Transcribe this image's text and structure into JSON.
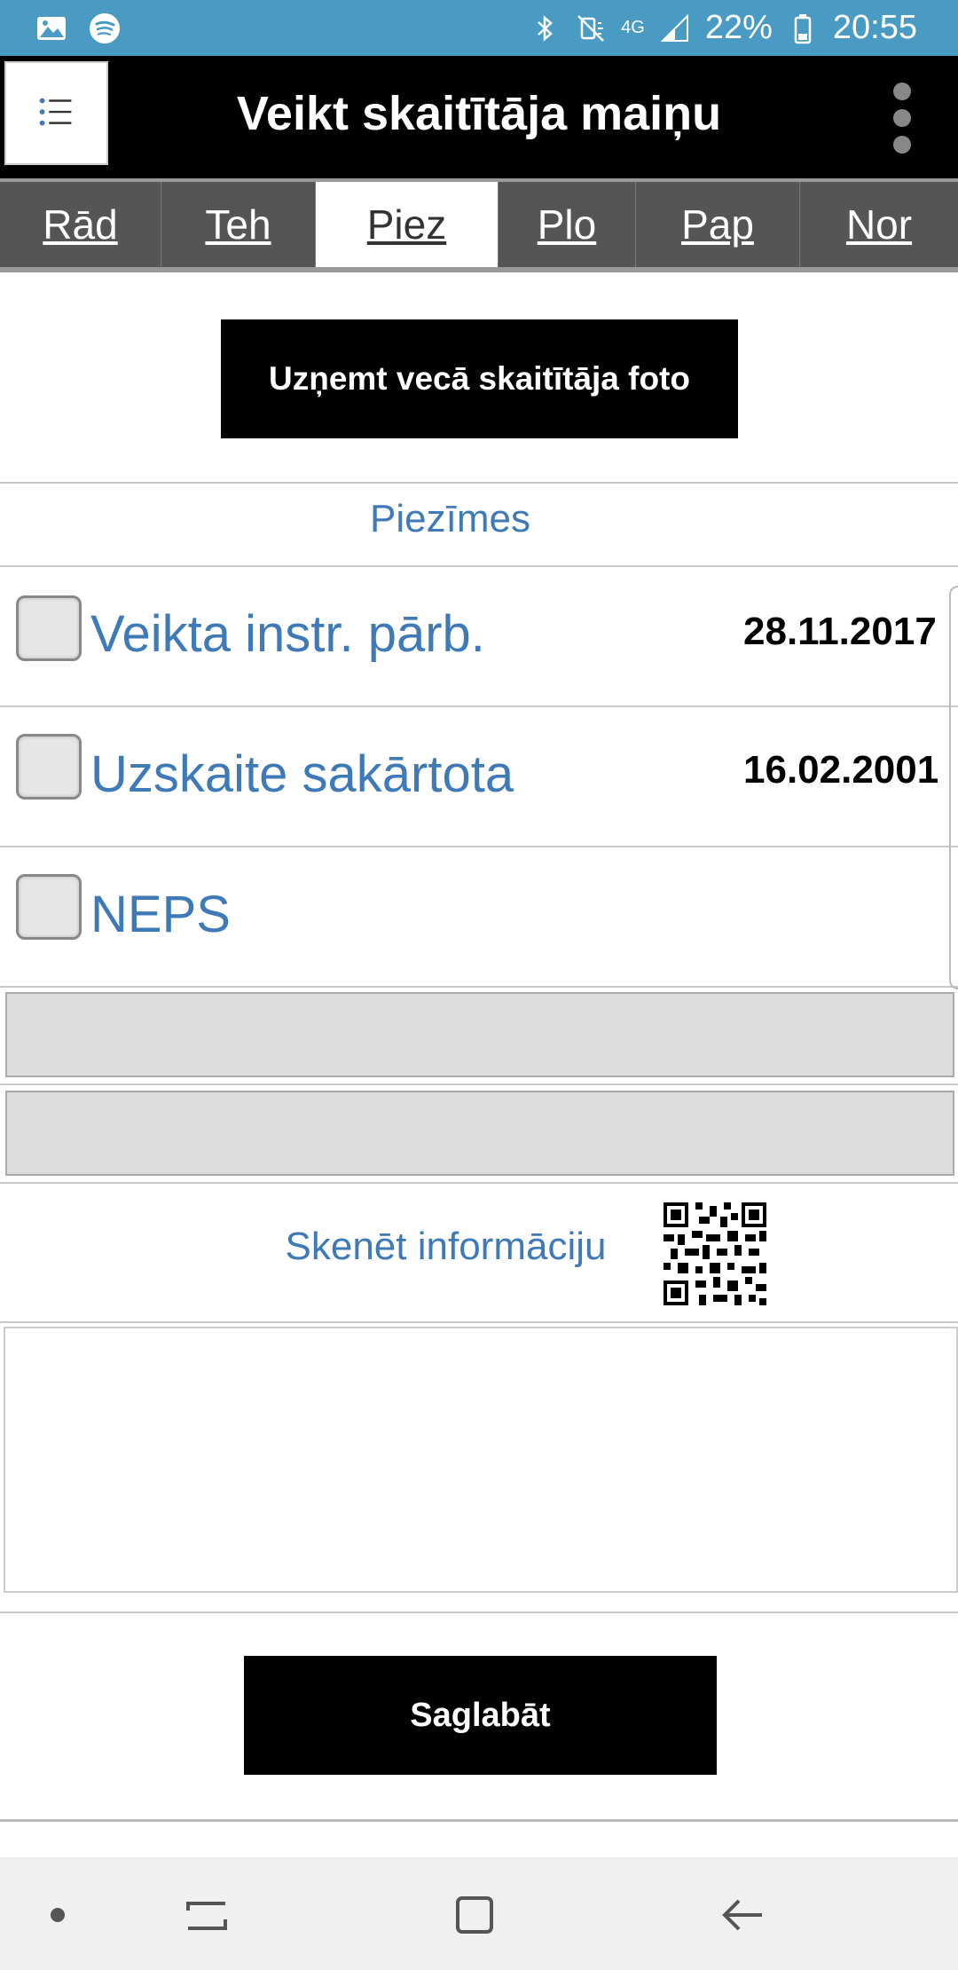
{
  "status_bar": {
    "battery": "22%",
    "time": "20:55",
    "network": "4G",
    "left_icons": [
      "gallery-icon",
      "spotify-icon"
    ],
    "right_icons": [
      "bluetooth-icon",
      "mute-icon",
      "signal-icon",
      "battery-icon"
    ]
  },
  "header": {
    "title": "Veikt skaitītāja maiņu",
    "menu_icon": "list-icon",
    "overflow_icon": "more-vert-icon"
  },
  "tabs": [
    {
      "label": "Rād",
      "active": false
    },
    {
      "label": "Teh",
      "active": false
    },
    {
      "label": "Piez",
      "active": true
    },
    {
      "label": "Plo",
      "active": false
    },
    {
      "label": "Pap",
      "active": false
    },
    {
      "label": "Nor",
      "active": false
    }
  ],
  "photo_button": "Uzņemt vecā skaitītāja foto",
  "notes_label": "Piezīmes",
  "checks": [
    {
      "label": "Veikta instr. pārb.",
      "date": "28.11.2017",
      "checked": false
    },
    {
      "label": "Uzskaite sakārtota",
      "date": "16.02.2001",
      "checked": false
    },
    {
      "label": "NEPS",
      "date": "",
      "checked": false
    }
  ],
  "fields": [
    {
      "value": ""
    },
    {
      "value": ""
    }
  ],
  "scan_label": "Skenēt informāciju",
  "scan_icon": "qr-code-icon",
  "notes_text": "",
  "save_button": "Saglabāt",
  "nav": [
    "dot-icon",
    "recent-apps-icon",
    "home-icon",
    "back-icon"
  ],
  "colors": {
    "status_bar": "#4a9bc4",
    "accent_text": "#3f7ab8",
    "header_bg": "#000000",
    "tab_bg": "#555555"
  }
}
